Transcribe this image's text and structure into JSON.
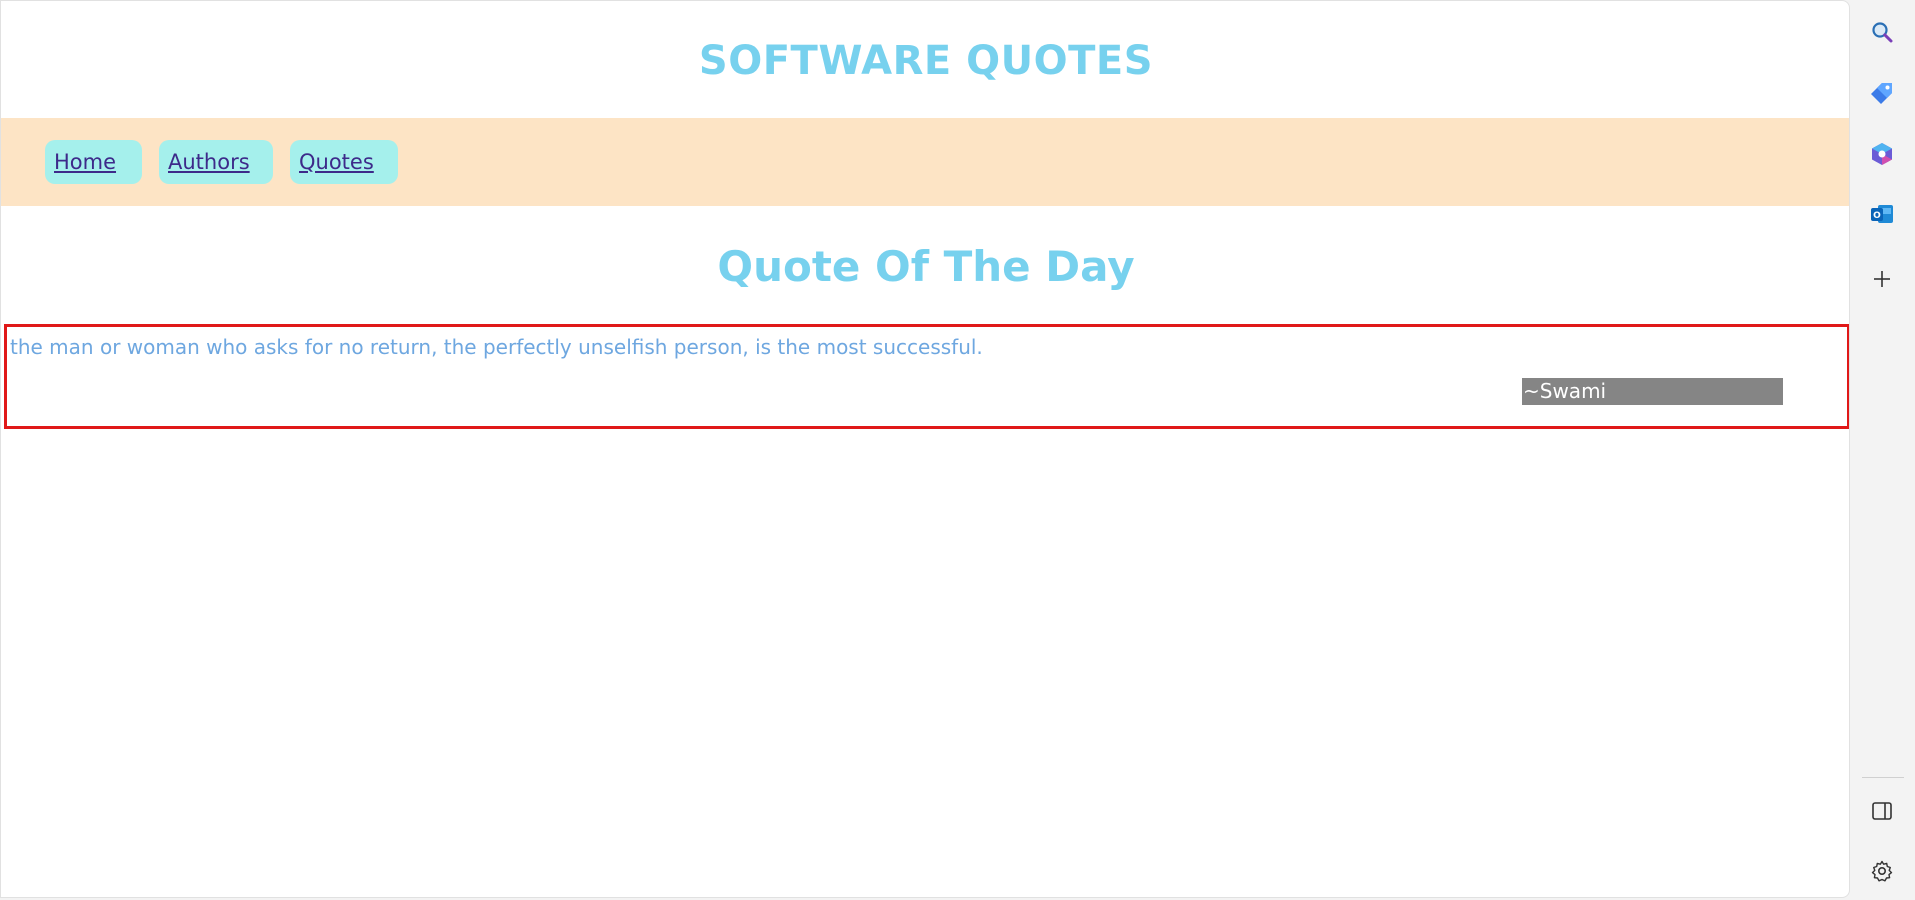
{
  "site": {
    "title": "SOFTWARE QUOTES"
  },
  "nav": {
    "items": [
      {
        "label": "Home"
      },
      {
        "label": "Authors"
      },
      {
        "label": "Quotes"
      }
    ]
  },
  "main": {
    "heading": "Quote Of The Day",
    "quote": {
      "text": "the man or woman who asks for no return, the perfectly unselfish person, is the most successful.",
      "author": "~Swami"
    }
  },
  "sidebar": {
    "icons": [
      "search-icon",
      "shopping-tag-icon",
      "copilot-icon",
      "outlook-icon",
      "add-icon",
      "split-screen-icon",
      "settings-icon"
    ]
  },
  "colors": {
    "title": "#77d1ee",
    "nav_background": "#fde4c5",
    "nav_button": "#a5f0ec",
    "nav_link": "#3d2a8a",
    "quote_text": "#6ea7e0",
    "quote_border": "#e01818",
    "author_background": "#858585"
  }
}
